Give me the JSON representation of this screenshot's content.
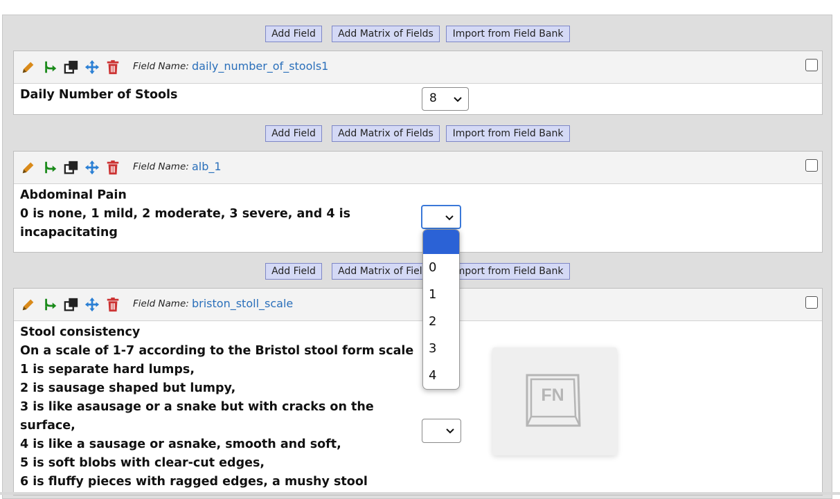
{
  "buttons": {
    "add_field": "Add Field",
    "add_matrix": "Add Matrix of Fields",
    "import_bank": "Import from Field Bank"
  },
  "field_name_label": "Field Name:",
  "fields": [
    {
      "name": "daily_number_of_stools1",
      "question": [
        "Daily Number of Stools"
      ],
      "selected_value": "8"
    },
    {
      "name": "alb_1",
      "question": [
        "Abdominal Pain",
        "0 is none, 1 mild, 2 moderate, 3 severe, and 4 is",
        "incapacitating"
      ],
      "selected_value": ""
    },
    {
      "name": "briston_stoll_scale",
      "question": [
        "Stool consistency",
        "On a scale of 1-7 according to the Bristol stool form scale",
        "1 is separate hard lumps,",
        "2 is sausage shaped but lumpy,",
        "3 is like asausage or a snake but with cracks on the",
        "surface,",
        "4 is like a sausage or asnake, smooth and soft,",
        "5 is soft blobs with clear-cut edges,",
        "6 is fluffy pieces with ragged edges, a mushy stool"
      ],
      "selected_value": ""
    }
  ],
  "dropdown_options": [
    "",
    "0",
    "1",
    "2",
    "3",
    "4"
  ],
  "fn_key_label": "FN",
  "icons": [
    "pencil-icon",
    "branch-icon",
    "copy-icon",
    "move-icon",
    "trash-icon"
  ],
  "colors": {
    "button_bg": "#d4d9f5",
    "link": "#2a6fba",
    "highlight": "#2b62d6",
    "pencil": "#d98a1a",
    "branch": "#1a8a1a",
    "move": "#2a7fd4",
    "trash": "#cc3333"
  }
}
